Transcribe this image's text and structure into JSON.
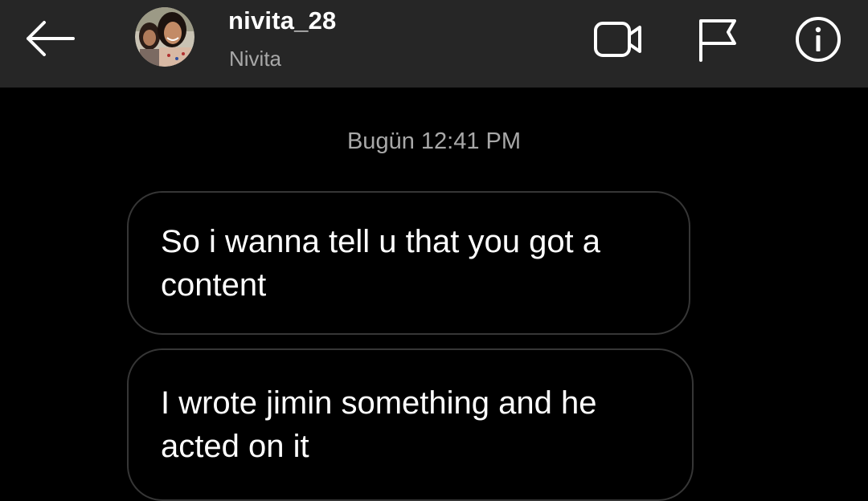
{
  "header": {
    "back_icon": "arrow-left-icon",
    "username": "nivita_28",
    "full_name": "Nivita",
    "actions": [
      {
        "icon": "video-camera-icon"
      },
      {
        "icon": "flag-icon"
      },
      {
        "icon": "info-icon"
      }
    ]
  },
  "thread": {
    "timestamp": "Bugün 12:41 PM",
    "messages": [
      {
        "text": "So i wanna tell u that you got a\ncontent"
      },
      {
        "text": "I wrote jimin something and he\nacted on it"
      }
    ]
  },
  "colors": {
    "header_bg": "#262626",
    "background": "#000000",
    "bubble_border": "#363636",
    "secondary_text": "#a8a8a8"
  }
}
